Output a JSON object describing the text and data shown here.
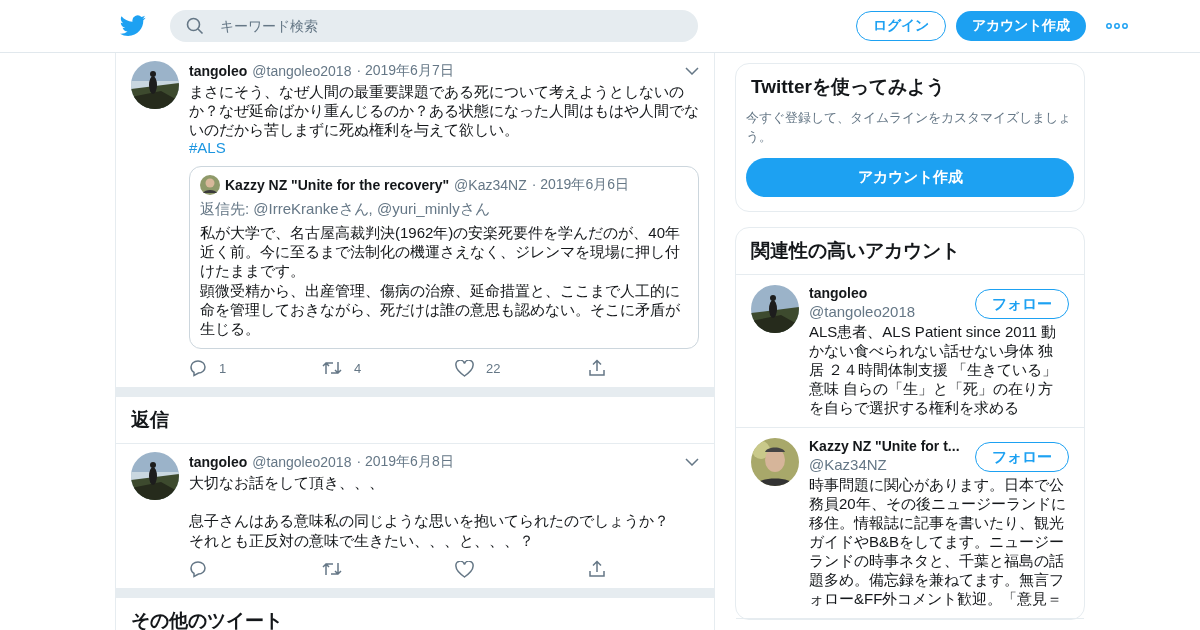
{
  "header": {
    "search_placeholder": "キーワード検索",
    "login": "ログイン",
    "signup": "アカウント作成"
  },
  "tweets": [
    {
      "name": "tangoleo",
      "handle": "@tangoleo2018",
      "date": "· 2019年6月7日",
      "paragraphs": [
        [
          "まさにそう、なぜ人間の最重要課題である死について考えようとしないのか？なぜ延命ばかり重んじるのか？ある状態になった人間はもはや人間でないのだから苦しまずに死ぬ権利を与えて欲しい。"
        ]
      ],
      "hashtag": "#ALS",
      "quote": {
        "name": "Kazzy NZ \"Unite for the recovery\"",
        "handle": "@Kaz34NZ",
        "date": "· 2019年6月6日",
        "reply_to": "返信先: @IrreKrankeさん, @yuri_minlyさん",
        "lines": [
          "私が大学で、名古屋高裁判決(1962年)の安楽死要件を学んだのが、40年近く前。今に至るまで法制化の機運さえなく、ジレンマを現場に押し付けたままです。",
          "顕微受精から、出産管理、傷病の治療、延命措置と、ここまで人工的に命を管理しておきながら、死だけは誰の意思も認めない。そこに矛盾が生じる。"
        ]
      },
      "actions": [
        {
          "kind": "reply",
          "count": "1"
        },
        {
          "kind": "retweet",
          "count": "4"
        },
        {
          "kind": "like",
          "count": "22"
        },
        {
          "kind": "share"
        }
      ]
    }
  ],
  "replies_heading": "返信",
  "replies": [
    {
      "name": "tangoleo",
      "handle": "@tangoleo2018",
      "date": "· 2019年6月8日",
      "paragraphs": [
        [
          "大切なお話をして頂き、、、"
        ],
        [
          "息子さんはある意味私の同じような思いを抱いてられたのでしょうか？",
          "それとも正反対の意味で生きたい、、、と、、、？"
        ]
      ],
      "actions": [
        {
          "kind": "reply"
        },
        {
          "kind": "retweet"
        },
        {
          "kind": "like"
        },
        {
          "kind": "share"
        }
      ]
    }
  ],
  "more_heading": "その他のツイート",
  "signup_card": {
    "title": "Twitterを使ってみよう",
    "subtitle": "今すぐ登録して、タイムラインをカスタマイズしましょう。",
    "button": "アカウント作成"
  },
  "related": {
    "title": "関連性の高いアカウント",
    "accounts": [
      {
        "name": "tangoleo",
        "handle": "@tangoleo2018",
        "follow": "フォロー",
        "bio_lines": [
          "ALS患者、ALS Patient since 2011 動",
          "かない食べられない話せない身体 独",
          "居 ２４時間体制支援 「生きている」",
          "意味 自らの「生」と「死」の在り方",
          "を自らで選択する権利を求める"
        ]
      },
      {
        "name": "Kazzy NZ \"Unite for t...",
        "handle": "@Kaz34NZ",
        "follow": "フォロー",
        "bio_lines": [
          "時事問題に関心があります。日本で公",
          "務員20年、その後ニュージーランドに",
          "移住。情報誌に記事を書いたり、観光",
          "ガイドやB&Bをしてます。ニュージー",
          "ランドの時事ネタと、千葉と福島の話",
          "題多め。備忘録を兼ねてます。無言フ",
          "ォロー&FF外コメント歓迎。「意見＝"
        ]
      }
    ]
  }
}
